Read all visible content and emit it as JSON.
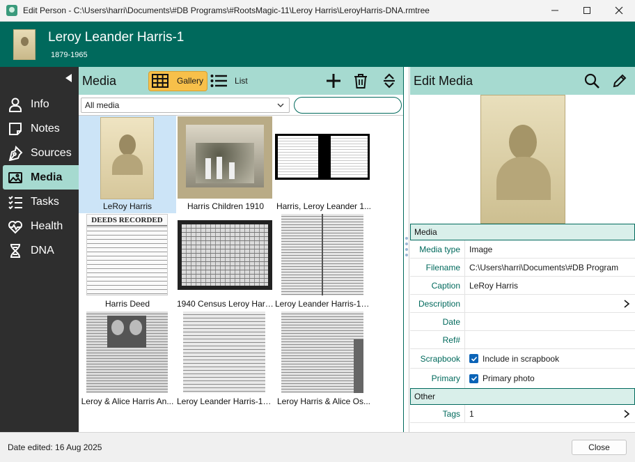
{
  "window": {
    "title": "Edit Person - C:\\Users\\harri\\Documents\\#DB Programs\\#RootsMagic-11\\Leroy Harris\\LeroyHarris-DNA.rmtree"
  },
  "person": {
    "name": "Leroy Leander Harris-1",
    "years": "1879-1965"
  },
  "sidebar": {
    "items": [
      {
        "label": "Info",
        "icon": "person-icon"
      },
      {
        "label": "Notes",
        "icon": "note-icon"
      },
      {
        "label": "Sources",
        "icon": "pen-nib-icon"
      },
      {
        "label": "Media",
        "icon": "image-icon",
        "active": true
      },
      {
        "label": "Tasks",
        "icon": "checklist-icon"
      },
      {
        "label": "Health",
        "icon": "heart-pulse-icon"
      },
      {
        "label": "DNA",
        "icon": "dna-icon"
      }
    ]
  },
  "media": {
    "title": "Media",
    "gallery_label": "Gallery",
    "list_label": "List",
    "filter_value": "All media",
    "search_placeholder": "",
    "items": [
      {
        "caption": "LeRoy Harris",
        "selected": true
      },
      {
        "caption": "Harris Children 1910"
      },
      {
        "caption": "Harris, Leroy Leander 1..."
      },
      {
        "caption": "Harris Deed"
      },
      {
        "caption": "1940 Census Leroy Harr..."
      },
      {
        "caption": "Leroy Leander Harris-19..."
      },
      {
        "caption": "Leroy & Alice Harris An..."
      },
      {
        "caption": "Leroy Leander Harris-19..."
      },
      {
        "caption": "Leroy Harris & Alice Os..."
      }
    ],
    "thumb_text": {
      "deeds_heading": "DEEDS RECORDED"
    }
  },
  "edit_media": {
    "title": "Edit Media",
    "section_media": "Media",
    "section_other": "Other",
    "fields": {
      "media_type_label": "Media type",
      "media_type_value": "Image",
      "filename_label": "Filename",
      "filename_value": "C:\\Users\\harri\\Documents\\#DB Program",
      "caption_label": "Caption",
      "caption_value": "LeRoy Harris",
      "description_label": "Description",
      "description_value": "",
      "date_label": "Date",
      "date_value": "",
      "ref_label": "Ref#",
      "ref_value": "",
      "scrapbook_label": "Scrapbook",
      "scrapbook_value": "Include in scrapbook",
      "primary_label": "Primary",
      "primary_value": "Primary photo",
      "tags_label": "Tags",
      "tags_value": "1"
    }
  },
  "status": {
    "date_edited": "Date edited: 16 Aug 2025",
    "close_label": "Close"
  },
  "colors": {
    "header": "#00695c",
    "accent": "#a6dad0",
    "gallery_button": "#f7c04a",
    "sidebar": "#2e2e2e"
  }
}
